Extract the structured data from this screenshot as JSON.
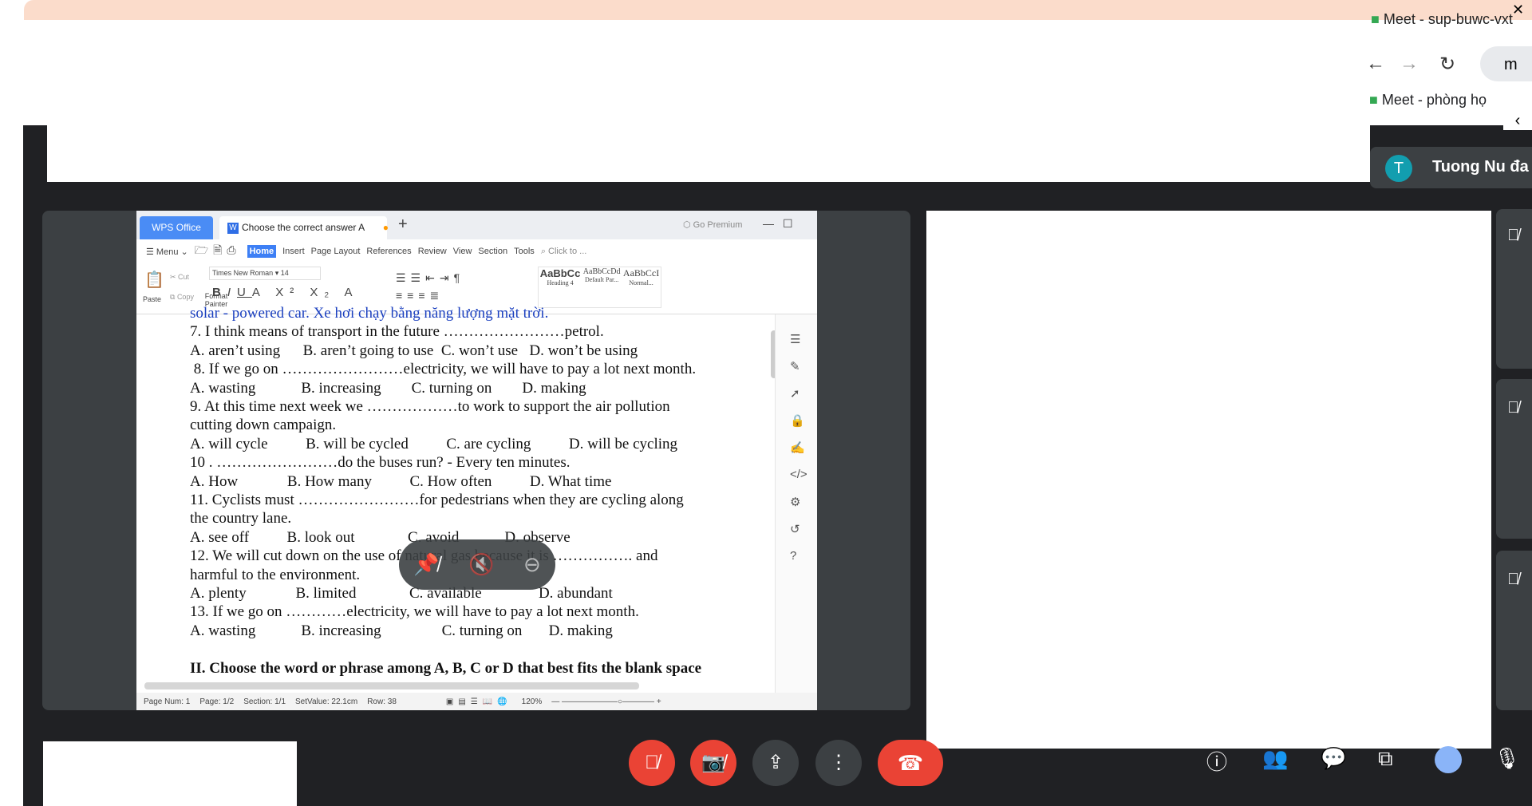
{
  "browser": {
    "tab_title": "Meet - sup-buwc-vxt",
    "page_title": "Meet - phòng họ",
    "url_fragment": "m"
  },
  "participant": {
    "initial": "T",
    "name": "Tuong Nu đa"
  },
  "wps": {
    "app_tab": "WPS Office",
    "doc_tab": "Choose the correct answer A",
    "go_premium": "Go Premium",
    "menu": [
      "Menu",
      "Home",
      "Insert",
      "Page Layout",
      "References",
      "Review",
      "View",
      "Section",
      "Tools"
    ],
    "search": "Click to ...",
    "ribbon": {
      "paste": "Paste",
      "cut": "Cut",
      "copy": "Copy",
      "format_painter": "Format Painter",
      "font": "Times New Roman",
      "size": "14",
      "styles": [
        "AaBbCc",
        "AaBbCcDd",
        "AaBbCcI"
      ],
      "style_names": [
        "Heading 4",
        "Default Par...",
        "Normal..."
      ]
    },
    "lines": [
      "solar - powered car. Xe hơi chạy bằng năng lượng mặt trời.",
      "7. I think means of transport in the future ……………………petrol.",
      "A. aren’t using      B. aren’t going to use  C. won’t use   D. won’t be using",
      " 8. If we go on ……………………electricity, we will have to pay a lot next month.",
      "A. wasting            B. increasing        C. turning on        D. making",
      "9. At this time next week we ………………to work to support the air pollution",
      "cutting down campaign.",
      "A. will cycle          B. will be cycled          C. are cycling          D. will be cycling",
      "10 . ……………………do the buses run? - Every ten minutes.",
      "A. How             B. How many          C. How often          D. What time",
      "11. Cyclists must ……………………for pedestrians when they are cycling along",
      "the country lane.",
      "A. see off          B. look out              C. avoid            D. observe",
      "12. We will cut down on the use of natural gas because it is ……………. and",
      "harmful to the environment.",
      "A. plenty             B. limited              C. available               D. abundant",
      "13. If we go on …………electricity, we will have to pay a lot next month.",
      "A. wasting            B. increasing                C. turning on       D. making",
      "",
      "II. Choose the word or phrase among A, B, C or D that best fits the blank space"
    ],
    "status": {
      "page_num": "Page Num: 1",
      "page": "Page: 1/2",
      "section": "Section: 1/1",
      "setvalue": "SetValue: 22.1cm",
      "row": "Row: 38",
      "zoom": "120%"
    }
  },
  "colors": {
    "meet_bg": "#202124",
    "panel": "#3c4043",
    "red": "#ea4335",
    "wps_blue": "#4a8cf5"
  }
}
